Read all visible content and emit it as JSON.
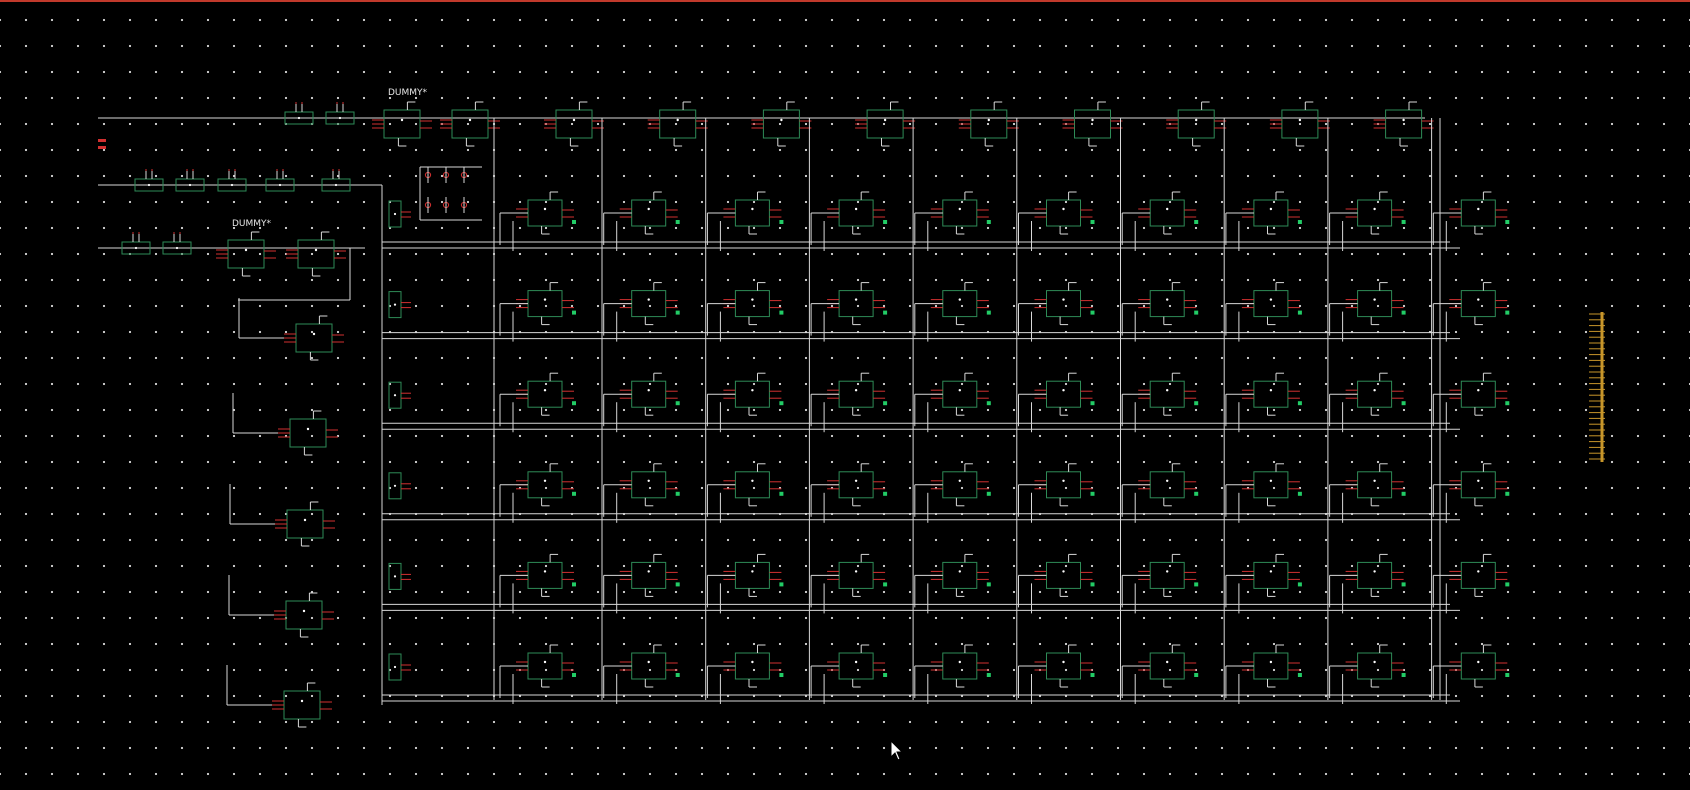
{
  "editor": {
    "canvas_name": "schematic-canvas",
    "labels": {
      "dummy_top": "DUMMY*",
      "dummy_left": "DUMMY*"
    },
    "grid": {
      "rows": 6,
      "cols": 10
    },
    "colors": {
      "background": "#000000",
      "grid_dot": "#cfcfcf",
      "wire": "#d8d8d8",
      "component_outline": "#2e8b57",
      "pin": "#d23030",
      "pin_terminal": "#22cc66",
      "connector": "#c8962a",
      "top_border": "#c0392b"
    },
    "icons": [
      "mouse-pointer-icon"
    ]
  }
}
